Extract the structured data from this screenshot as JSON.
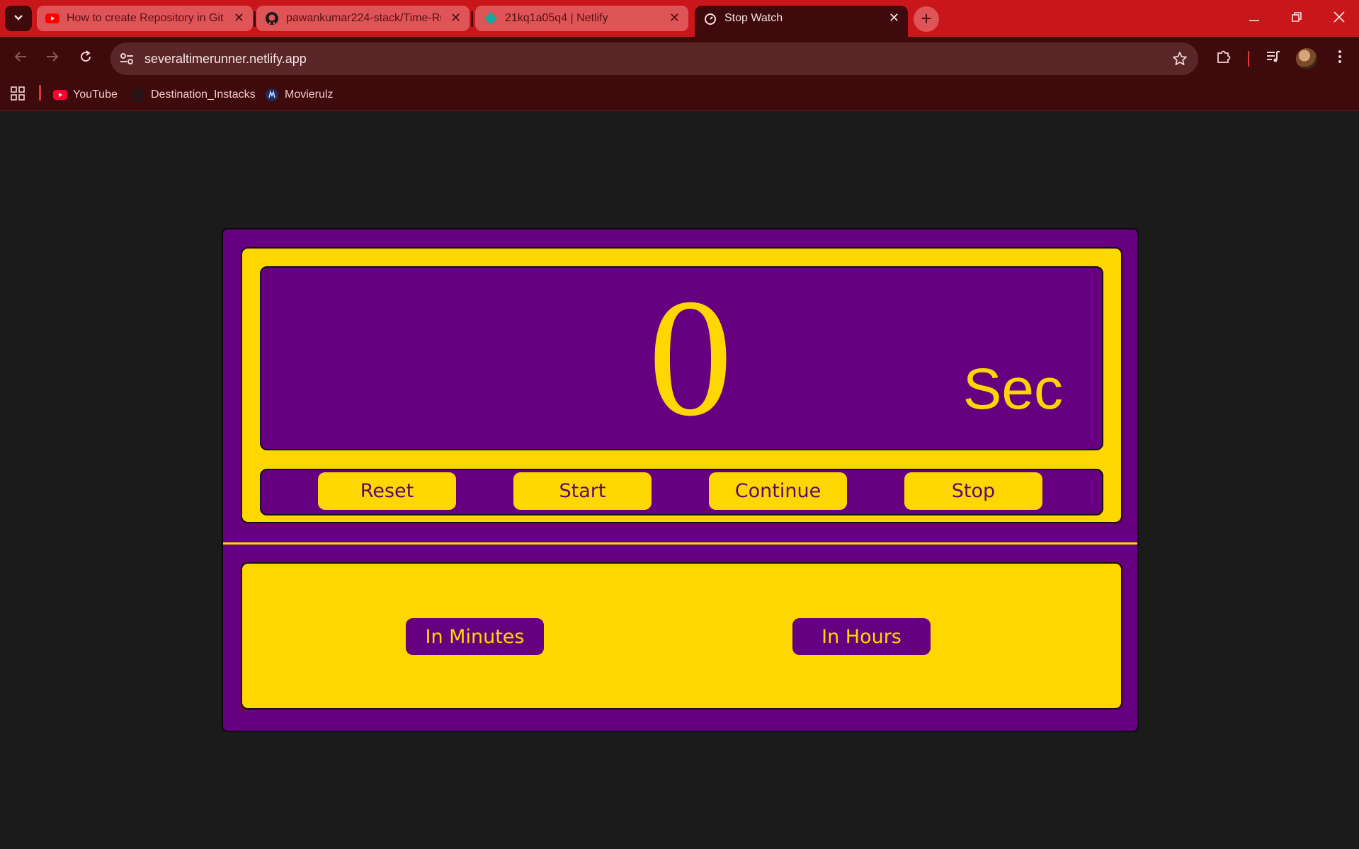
{
  "browser": {
    "tabs": [
      {
        "title": "How to create Repository in Git",
        "favicon": "youtube-icon"
      },
      {
        "title": "pawankumar224-stack/Time-Ru",
        "favicon": "github-icon"
      },
      {
        "title": "21kq1a05q4 | Netlify",
        "favicon": "netlify-icon"
      },
      {
        "title": "Stop Watch",
        "favicon": "stopwatch-icon",
        "active": true
      }
    ],
    "url": "severaltimerunner.netlify.app",
    "bookmarks": [
      {
        "label": "YouTube",
        "icon": "youtube-icon"
      },
      {
        "label": "Destination_Instacks",
        "icon": "globe-icon"
      },
      {
        "label": "Movierulz",
        "icon": "movierulz-icon"
      }
    ]
  },
  "stopwatch": {
    "value": "0",
    "unit": "Sec",
    "controls": {
      "reset": "Reset",
      "start": "Start",
      "continue": "Continue",
      "stop": "Stop"
    },
    "conversions": {
      "minutes": "In Minutes",
      "hours": "In Hours"
    }
  },
  "colors": {
    "purple": "#660080",
    "gold": "#ffd700",
    "page_background": "#1b1b1b",
    "browser_red": "#c8161b",
    "browser_dark": "#3e0a0c"
  }
}
